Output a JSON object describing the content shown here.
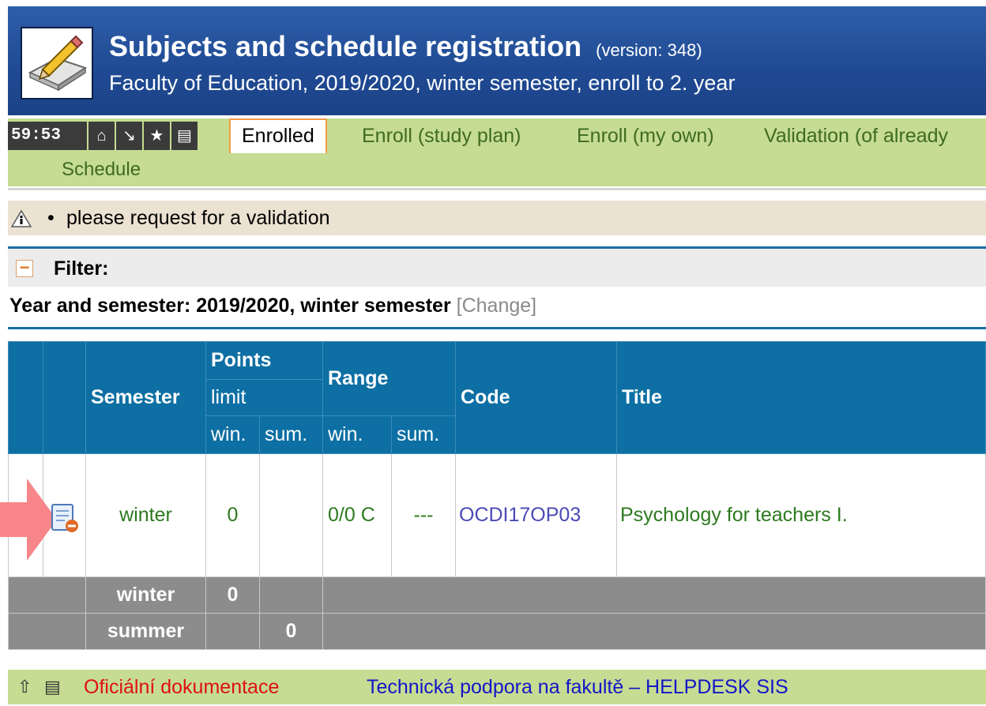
{
  "header": {
    "title": "Subjects and schedule registration",
    "version": "(version: 348)",
    "subtitle": "Faculty of Education, 2019/2020, winter semester, enroll to 2. year"
  },
  "toolbar": {
    "timer": "59:53",
    "icons": [
      "home-icon",
      "arrow-down-right-icon",
      "star-icon",
      "printer-icon"
    ]
  },
  "tabs": {
    "enrolled": "Enrolled",
    "enroll_plan": "Enroll (study plan)",
    "enroll_own": "Enroll (my own)",
    "validation": "Validation (of already",
    "schedule": "Schedule"
  },
  "info": {
    "bullet": "•",
    "message": "please request for a validation"
  },
  "filter": {
    "label": "Filter:",
    "year_label": "Year and semester: 2019/2020, winter semester",
    "change": "[Change]"
  },
  "table": {
    "headers": {
      "semester": "Semester",
      "points": "Points",
      "limit": "limit",
      "range": "Range",
      "code": "Code",
      "title": "Title",
      "win1": "win.",
      "sum1": "sum.",
      "win2": "win.",
      "sum2": "sum."
    },
    "row": {
      "semester": "winter",
      "limit_win": "0",
      "range_win": "0/0 C",
      "range_sum": "---",
      "code": "OCDI17OP03",
      "title": "Psychology for teachers I."
    },
    "totals": [
      {
        "semester": "winter",
        "win": "0",
        "sum": ""
      },
      {
        "semester": "summer",
        "win": "",
        "sum": "0"
      }
    ]
  },
  "footer": {
    "documentation": "Oficiální dokumentace",
    "helpdesk": "Technická podpora na fakultě – HELPDESK SIS"
  },
  "colors": {
    "header_blue": "#1f4a93",
    "tab_green": "#c5dc92",
    "table_header": "#0d6fa3",
    "arrow": "#f78589"
  }
}
